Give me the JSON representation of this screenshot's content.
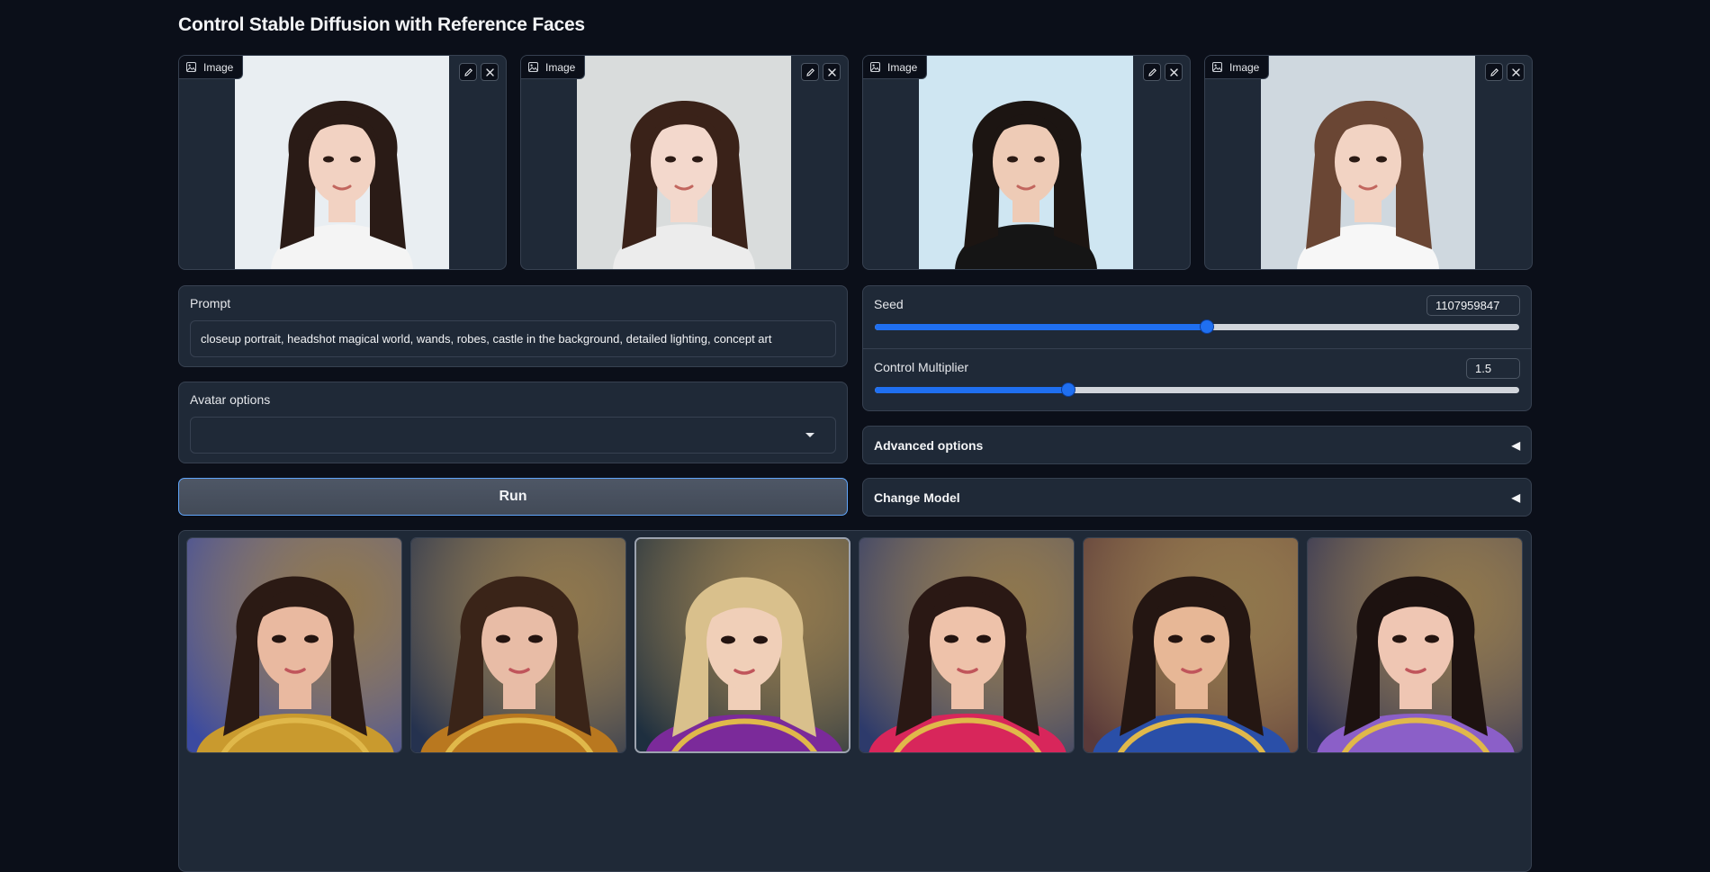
{
  "page": {
    "title": "Control Stable Diffusion with Reference Faces"
  },
  "uploads": [
    {
      "label": "Image",
      "bg": "#e9eef2",
      "hair": "#2a1b16",
      "skin": "#f2d2c2",
      "shirt": "#f4f4f4"
    },
    {
      "label": "Image",
      "bg": "#d9dcdc",
      "hair": "#3a2219",
      "skin": "#f3d8cc",
      "shirt": "#ececec"
    },
    {
      "label": "Image",
      "bg": "#cfe6f2",
      "hair": "#1c1512",
      "skin": "#eecbb6",
      "shirt": "#151515"
    },
    {
      "label": "Image",
      "bg": "#cfd8df",
      "hair": "#6a4634",
      "skin": "#f2d3c3",
      "shirt": "#f7f7f7"
    }
  ],
  "prompt": {
    "label": "Prompt",
    "value": "closeup portrait, headshot magical world, wands, robes, castle in the background, detailed lighting, concept art"
  },
  "avatar": {
    "label": "Avatar options",
    "value": ""
  },
  "run": {
    "label": "Run"
  },
  "seed": {
    "label": "Seed",
    "value": "1107959847",
    "min": 0,
    "max": 2147483647,
    "level": 0.5157
  },
  "control": {
    "label": "Control Multiplier",
    "value": "1.5",
    "level": 0.3
  },
  "advanced": {
    "label": "Advanced options",
    "arrow": "◀"
  },
  "change_model": {
    "label": "Change Model",
    "arrow": "◀"
  },
  "gallery": [
    {
      "bg": "#3b4aa0",
      "hair": "#2b1a14",
      "skin": "#e9b9a0",
      "robe": "#c99a2e",
      "selected": false
    },
    {
      "bg": "#25324f",
      "hair": "#3a2418",
      "skin": "#e8bca6",
      "robe": "#b9781f",
      "selected": false
    },
    {
      "bg": "#1e2f3f",
      "hair": "#d9c08c",
      "skin": "#f0cfb8",
      "robe": "#7b2a9a",
      "selected": true
    },
    {
      "bg": "#2d3a6b",
      "hair": "#2a1814",
      "skin": "#eec2aa",
      "robe": "#d8265b",
      "selected": false
    },
    {
      "bg": "#5a3a3a",
      "hair": "#241612",
      "skin": "#e7b796",
      "robe": "#2a4fa8",
      "selected": false
    },
    {
      "bg": "#2a2f55",
      "hair": "#1d1210",
      "skin": "#efc6b3",
      "robe": "#8b5fc8",
      "selected": false
    }
  ]
}
